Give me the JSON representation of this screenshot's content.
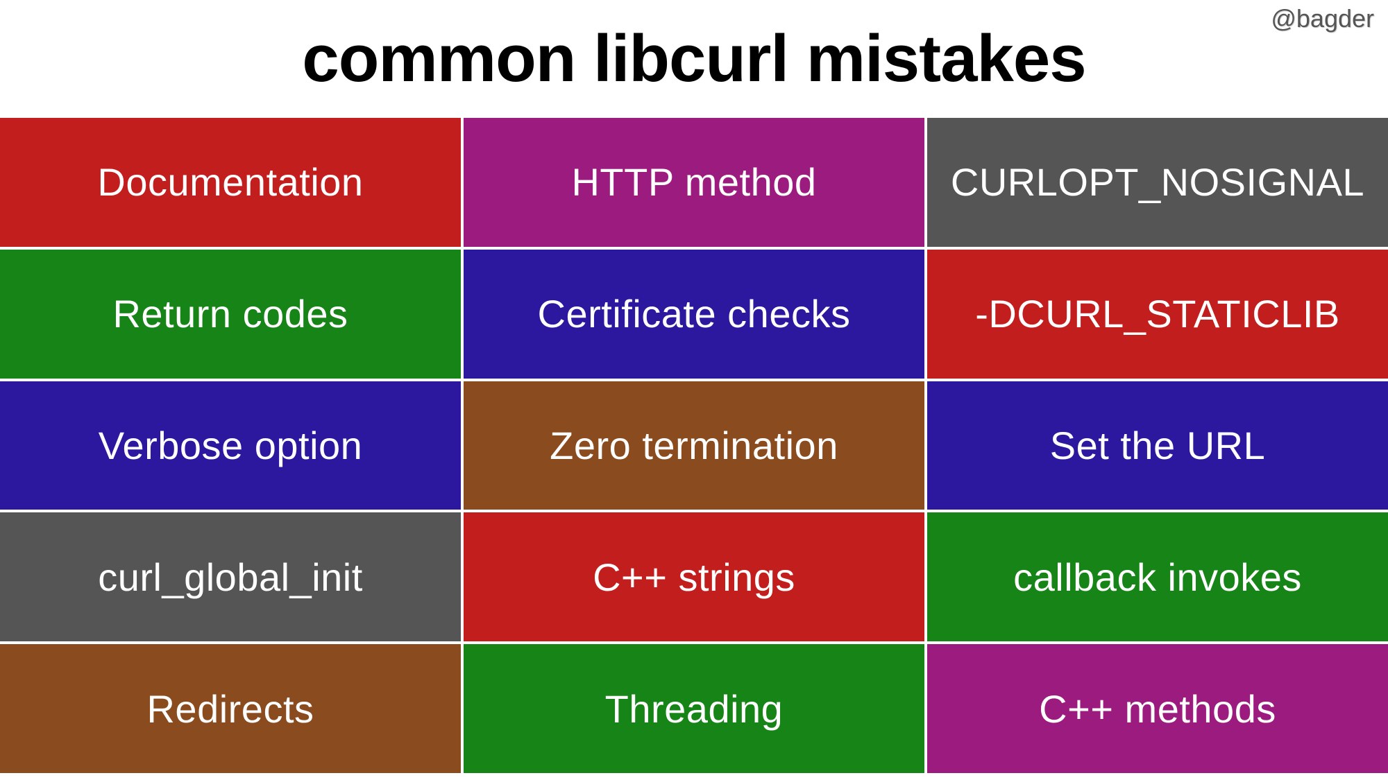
{
  "attribution": "@bagder",
  "title": "common libcurl mistakes",
  "colors": {
    "red": "#c21e1e",
    "green": "#178417",
    "blue": "#2b189f",
    "gray": "#555555",
    "brown": "#8a4b1f",
    "magenta": "#9c1b7f"
  },
  "cells": [
    {
      "label": "Documentation",
      "color": "red"
    },
    {
      "label": "HTTP method",
      "color": "magenta"
    },
    {
      "label": "CURLOPT_NOSIGNAL",
      "color": "gray"
    },
    {
      "label": "Return codes",
      "color": "green"
    },
    {
      "label": "Certificate checks",
      "color": "blue"
    },
    {
      "label": "-DCURL_STATICLIB",
      "color": "red"
    },
    {
      "label": "Verbose option",
      "color": "blue"
    },
    {
      "label": "Zero termination",
      "color": "brown"
    },
    {
      "label": "Set the URL",
      "color": "blue"
    },
    {
      "label": "curl_global_init",
      "color": "gray"
    },
    {
      "label": "C++ strings",
      "color": "red"
    },
    {
      "label": "callback invokes",
      "color": "green"
    },
    {
      "label": "Redirects",
      "color": "brown"
    },
    {
      "label": "Threading",
      "color": "green"
    },
    {
      "label": "C++ methods",
      "color": "magenta"
    }
  ]
}
